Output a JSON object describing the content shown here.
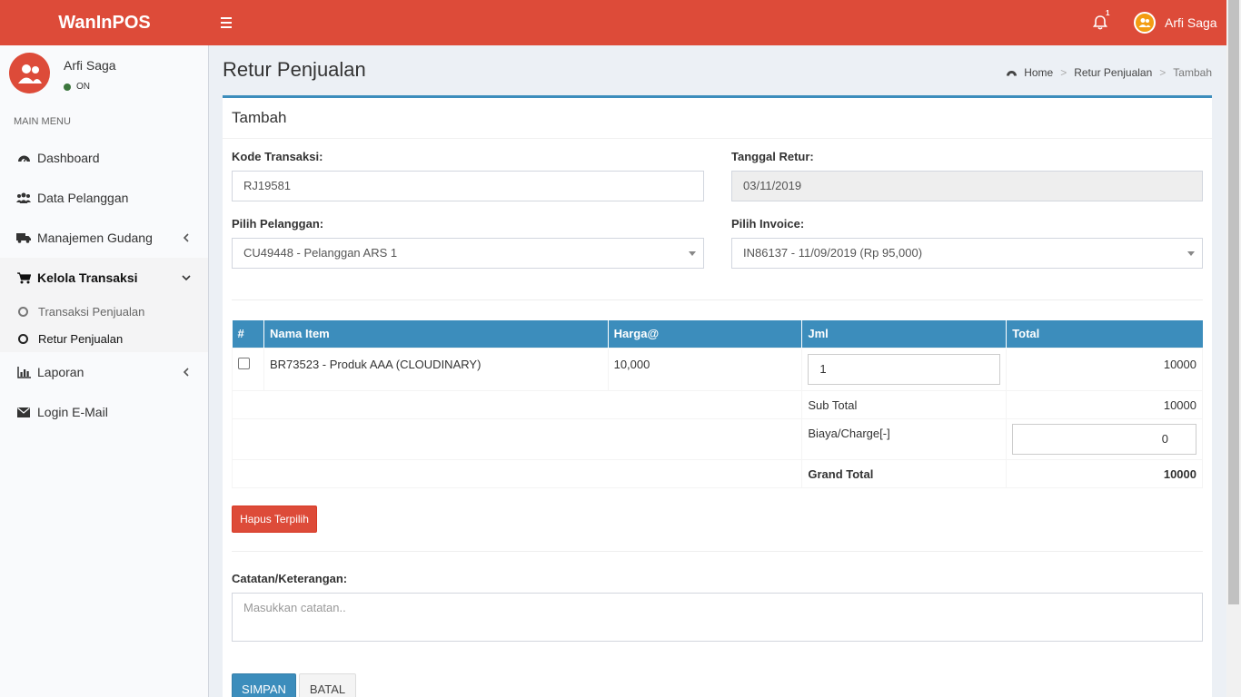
{
  "header": {
    "logo": "WanInPOS",
    "notification_count": "1",
    "user_name": "Arfi Saga"
  },
  "sidebar": {
    "user_name": "Arfi Saga",
    "status": "ON",
    "menu_header": "MAIN MENU",
    "items": [
      {
        "label": "Dashboard",
        "icon": "dashboard-icon"
      },
      {
        "label": "Data Pelanggan",
        "icon": "users-icon"
      },
      {
        "label": "Manajemen Gudang",
        "icon": "truck-icon"
      },
      {
        "label": "Kelola Transaksi",
        "icon": "cart-icon"
      },
      {
        "label": "Laporan",
        "icon": "chart-icon"
      },
      {
        "label": "Login E-Mail",
        "icon": "envelope-icon"
      }
    ],
    "submenu": [
      {
        "label": "Transaksi Penjualan"
      },
      {
        "label": "Retur Penjualan"
      }
    ]
  },
  "page": {
    "title": "Retur Penjualan",
    "breadcrumb": [
      "Home",
      "Retur Penjualan",
      "Tambah"
    ]
  },
  "form": {
    "box_title": "Tambah",
    "kode_label": "Kode Transaksi:",
    "kode_value": "RJ19581",
    "tanggal_label": "Tanggal Retur:",
    "tanggal_value": "03/11/2019",
    "pelanggan_label": "Pilih Pelanggan:",
    "pelanggan_value": "CU49448 - Pelanggan ARS 1",
    "invoice_label": "Pilih Invoice:",
    "invoice_value": "IN86137 - 11/09/2019 (Rp 95,000)",
    "catatan_label": "Catatan/Keterangan:",
    "catatan_placeholder": "Masukkan catatan.."
  },
  "table": {
    "headers": [
      "#",
      "Nama Item",
      "Harga@",
      "Jml",
      "Total"
    ],
    "rows": [
      {
        "name": "BR73523 - Produk AAA (CLOUDINARY)",
        "price": "10,000",
        "qty": "1",
        "total": "10000"
      }
    ],
    "subtotal_label": "Sub Total",
    "subtotal_value": "10000",
    "charge_label": "Biaya/Charge[-]",
    "charge_value": "0",
    "grand_label": "Grand Total",
    "grand_value": "10000"
  },
  "buttons": {
    "hapus": "Hapus Terpilih",
    "simpan": "SIMPAN",
    "batal": "BATAL"
  },
  "colors": {
    "header": "#dd4b39",
    "primary": "#3c8dbc",
    "danger": "#dd4b39"
  }
}
